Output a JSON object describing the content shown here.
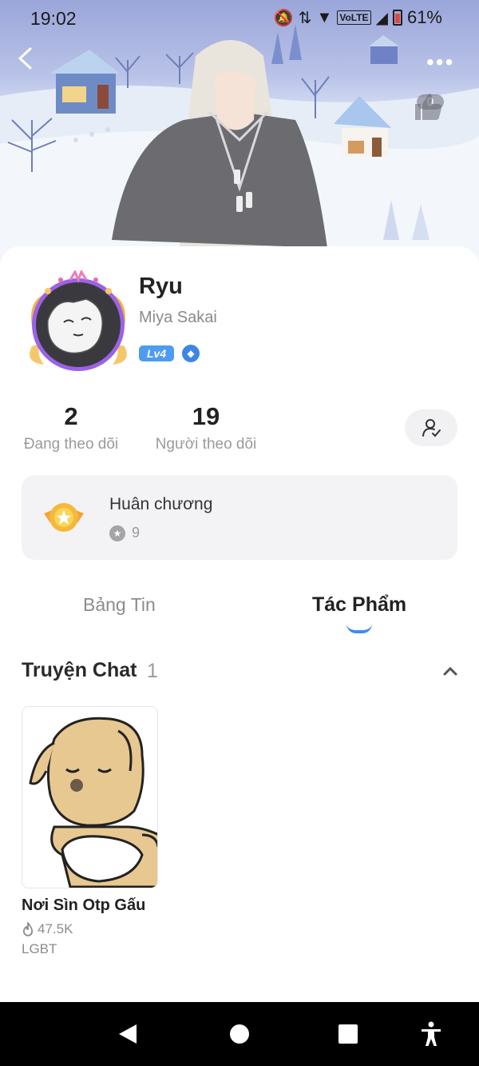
{
  "status_bar": {
    "time": "19:02",
    "network": "VoLTE",
    "battery": "61%"
  },
  "header": {
    "like_count": "0"
  },
  "profile": {
    "display_name": "Ryu",
    "username": "Miya Sakai",
    "level": "Lv4"
  },
  "stats": {
    "following_count": "2",
    "following_label": "Đang theo dõi",
    "followers_count": "19",
    "followers_label": "Người theo dõi"
  },
  "medals": {
    "title": "Huân chương",
    "count": "9"
  },
  "tabs": [
    {
      "label": "Bảng Tin",
      "active": false
    },
    {
      "label": "Tác Phẩm",
      "active": true
    }
  ],
  "section": {
    "title": "Truyện Chat",
    "count": "1"
  },
  "stories": [
    {
      "title": "Nơi Sìn Otp Gấu",
      "views": "47.5K",
      "tag": "LGBT"
    }
  ],
  "colors": {
    "accent": "#3d8df0",
    "level_badge": "#4e9bf2",
    "card_bg": "#f3f3f5"
  }
}
